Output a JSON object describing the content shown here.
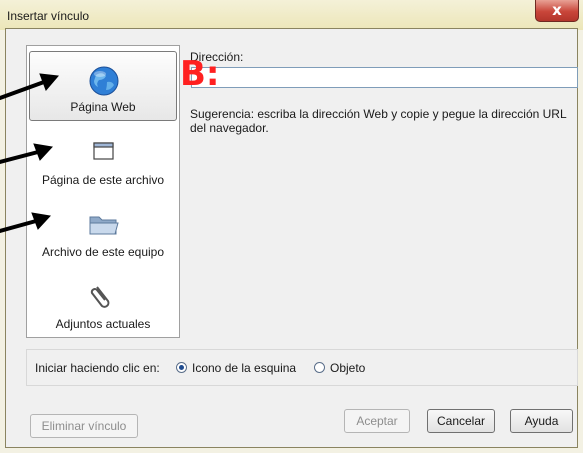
{
  "window": {
    "title": "Insertar vínculo",
    "close_glyph": "x"
  },
  "nav": {
    "items": [
      {
        "label": "Página Web",
        "icon": "globe-icon",
        "selected": true
      },
      {
        "label": "Página de este archivo",
        "icon": "window-icon",
        "selected": false
      },
      {
        "label": "Archivo de este equipo",
        "icon": "folder-icon",
        "selected": false
      },
      {
        "label": "Adjuntos actuales",
        "icon": "paperclip-icon",
        "selected": false
      }
    ]
  },
  "address": {
    "label": "Dirección:",
    "value": "",
    "hint": "Sugerencia: escriba la dirección Web y copie y pegue la dirección URL del navegador."
  },
  "start_options": {
    "label": "Iniciar haciendo clic en:",
    "options": [
      {
        "label": "Icono de la esquina",
        "checked": true
      },
      {
        "label": "Objeto",
        "checked": false
      }
    ]
  },
  "buttons": {
    "remove_link": "Eliminar vínculo",
    "accept": "Aceptar",
    "cancel": "Cancelar",
    "help": "Ayuda"
  },
  "annotation": {
    "text": "B:",
    "color": "#ff2020"
  }
}
